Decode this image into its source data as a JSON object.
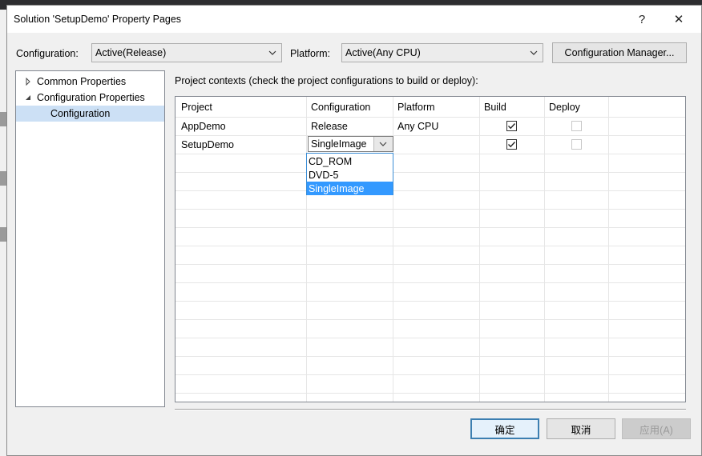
{
  "dialog": {
    "title": "Solution 'SetupDemo' Property Pages",
    "help_label": "?",
    "close_label": "✕"
  },
  "top": {
    "configuration_label": "Configuration:",
    "configuration_value": "Active(Release)",
    "platform_label": "Platform:",
    "platform_value": "Active(Any CPU)",
    "config_manager_label": "Configuration Manager..."
  },
  "tree": {
    "items": [
      {
        "label": "Common Properties",
        "expanded": false
      },
      {
        "label": "Configuration Properties",
        "expanded": true
      },
      {
        "label": "Configuration",
        "selected": true
      }
    ]
  },
  "grid": {
    "caption": "Project contexts (check the project configurations to build or deploy):",
    "columns": [
      "Project",
      "Configuration",
      "Platform",
      "Build",
      "Deploy"
    ],
    "rows": [
      {
        "project": "AppDemo",
        "configuration": "Release",
        "platform": "Any CPU",
        "build": true,
        "deploy": false
      },
      {
        "project": "SetupDemo",
        "configuration": "SingleImage",
        "platform": "",
        "build": true,
        "deploy": false
      }
    ],
    "dropdown_options": [
      "CD_ROM",
      "DVD-5",
      "SingleImage"
    ],
    "dropdown_selected": "SingleImage"
  },
  "buttons": {
    "ok": "确定",
    "cancel": "取消",
    "apply": "应用(A)"
  },
  "colors": {
    "selection": "#cce0f5",
    "highlight": "#3399ff",
    "primary_border": "#3c7fb1"
  }
}
